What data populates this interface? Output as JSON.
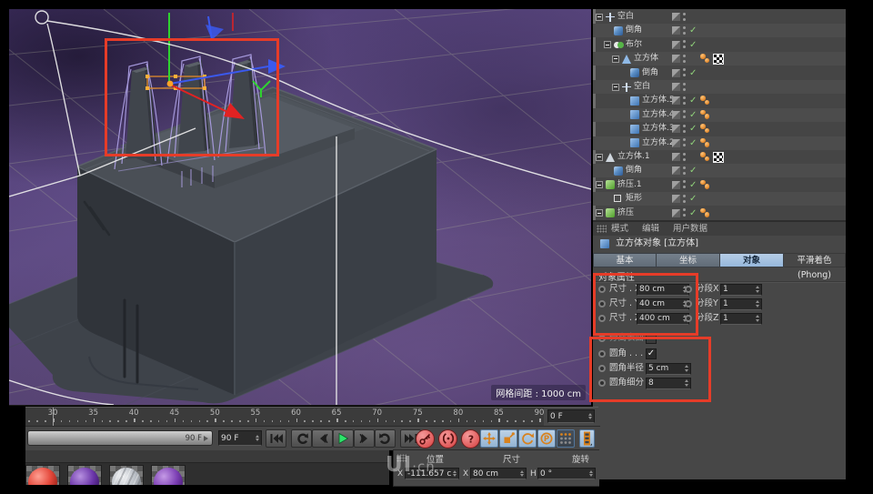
{
  "colors": {
    "panel": "#474747",
    "accent_tab_blue": "#96b8dc",
    "annotation_red": "#e63c28",
    "check_green": "#8fd17a",
    "tag_orange": "#e0862c",
    "play_green": "#2ee26a",
    "record_red": "#e05a5a",
    "viewport_purple": "#5d4a82"
  },
  "viewport": {
    "grid_spacing_label": "网格间距 : 1000 cm"
  },
  "object_manager": {
    "rows": [
      {
        "label": "空白",
        "icon": "null",
        "level": 0,
        "expander": true,
        "check": false,
        "tags": []
      },
      {
        "label": "倒角",
        "icon": "bevel",
        "level": 1,
        "expander": false,
        "check": true,
        "tags": []
      },
      {
        "label": "布尔",
        "icon": "boole",
        "level": 1,
        "expander": true,
        "check": true,
        "tags": []
      },
      {
        "label": "立方体",
        "icon": "cone",
        "level": 2,
        "expander": true,
        "check": false,
        "tags": [
          "phong",
          "texture"
        ]
      },
      {
        "label": "倒角",
        "icon": "bevel",
        "level": 3,
        "expander": false,
        "check": true,
        "tags": []
      },
      {
        "label": "空白",
        "icon": "null",
        "level": 2,
        "expander": true,
        "check": false,
        "tags": []
      },
      {
        "label": "立方体.5",
        "icon": "cube",
        "level": 3,
        "expander": false,
        "check": true,
        "tags": [
          "phong"
        ]
      },
      {
        "label": "立方体.4",
        "icon": "cube",
        "level": 3,
        "expander": false,
        "check": true,
        "tags": [
          "phong"
        ]
      },
      {
        "label": "立方体.3",
        "icon": "cube",
        "level": 3,
        "expander": false,
        "check": true,
        "tags": [
          "phong"
        ]
      },
      {
        "label": "立方体.2",
        "icon": "cube",
        "level": 3,
        "expander": false,
        "check": true,
        "tags": [
          "phong"
        ]
      },
      {
        "label": "立方体.1",
        "icon": "cone2",
        "level": 0,
        "expander": true,
        "check": false,
        "tags": [
          "phong",
          "texture"
        ]
      },
      {
        "label": "倒角",
        "icon": "bevel",
        "level": 1,
        "expander": false,
        "check": true,
        "tags": []
      },
      {
        "label": "挤压.1",
        "icon": "extrude",
        "level": 0,
        "expander": true,
        "check": true,
        "tags": [
          "phong"
        ]
      },
      {
        "label": "矩形",
        "icon": "rect",
        "level": 1,
        "expander": false,
        "check": true,
        "tags": []
      },
      {
        "label": "挤压",
        "icon": "extrude",
        "level": 0,
        "expander": true,
        "check": true,
        "tags": [
          "phong"
        ]
      }
    ]
  },
  "mode_bar": {
    "items": [
      "模式",
      "编辑",
      "用户数据"
    ]
  },
  "attributes": {
    "title": "立方体对象 [立方体]",
    "tabs": [
      {
        "label": "基本",
        "active": false
      },
      {
        "label": "坐标",
        "active": false
      },
      {
        "label": "对象",
        "active": true
      },
      {
        "label": "平滑着色(Phong)",
        "active": false
      }
    ],
    "section": "对象属性",
    "dim_rows": [
      {
        "label": "尺寸 . X",
        "value": "80 cm",
        "seg_label": "分段X",
        "seg_value": "1"
      },
      {
        "label": "尺寸 . Y",
        "value": "40 cm",
        "seg_label": "分段Y",
        "seg_value": "1"
      },
      {
        "label": "尺寸 . Z",
        "value": "400 cm",
        "seg_label": "分段Z",
        "seg_value": "1"
      }
    ],
    "separate_label": "分离表面",
    "fillet": {
      "label": "圆角 . . .",
      "checked": true,
      "check_glyph": "✓"
    },
    "fillet_radius": {
      "label": "圆角半径",
      "value": "5 cm"
    },
    "fillet_subdiv": {
      "label": "圆角细分",
      "value": "8"
    }
  },
  "timeline": {
    "labels": [
      30,
      35,
      40,
      45,
      50,
      55,
      60,
      65,
      70,
      75,
      80,
      85,
      90
    ],
    "first_frame": 27,
    "last_frame": 91,
    "marker_frame": 30,
    "range_slider_value": "90 F",
    "range_spinner_value": "90 F",
    "current_frame_value": "0 F"
  },
  "transport": {
    "buttons": [
      "go-to-start",
      "play-backwards",
      "previous-frame",
      "play-forwards",
      "next-frame",
      "play-loop",
      "go-to-end",
      "record-keyframe",
      "record-autokey",
      "record-options",
      "keyframe-position",
      "keyframe-scale",
      "keyframe-rotation",
      "keyframe-parameter",
      "keyframe-point-level",
      "motion-system"
    ]
  },
  "coordinates": {
    "headers": [
      "位置",
      "尺寸",
      "旋转"
    ],
    "fields": [
      {
        "axis": "X",
        "value": "-111.657 cm"
      },
      {
        "axis": "X",
        "value": "80 cm"
      },
      {
        "axis": "H",
        "value": "0 °"
      }
    ]
  },
  "materials": {
    "swatches": [
      "red",
      "purple",
      "tex",
      "purple2"
    ]
  },
  "watermark": {
    "big": "UI",
    "small": "·cn"
  }
}
